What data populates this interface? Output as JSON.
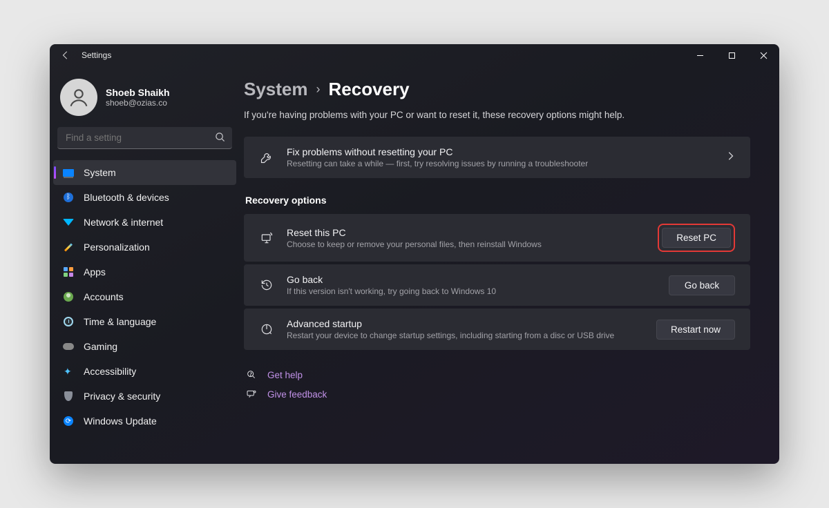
{
  "app_title": "Settings",
  "user": {
    "name": "Shoeb Shaikh",
    "email": "shoeb@ozias.co"
  },
  "search": {
    "placeholder": "Find a setting"
  },
  "nav": {
    "items": [
      {
        "label": "System"
      },
      {
        "label": "Bluetooth & devices"
      },
      {
        "label": "Network & internet"
      },
      {
        "label": "Personalization"
      },
      {
        "label": "Apps"
      },
      {
        "label": "Accounts"
      },
      {
        "label": "Time & language"
      },
      {
        "label": "Gaming"
      },
      {
        "label": "Accessibility"
      },
      {
        "label": "Privacy & security"
      },
      {
        "label": "Windows Update"
      }
    ]
  },
  "breadcrumb": {
    "parent": "System",
    "current": "Recovery"
  },
  "subtitle": "If you're having problems with your PC or want to reset it, these recovery options might help.",
  "trouble": {
    "title": "Fix problems without resetting your PC",
    "desc": "Resetting can take a while — first, try resolving issues by running a troubleshooter"
  },
  "section_header": "Recovery options",
  "options": {
    "reset": {
      "title": "Reset this PC",
      "desc": "Choose to keep or remove your personal files, then reinstall Windows",
      "button": "Reset PC"
    },
    "goback": {
      "title": "Go back",
      "desc": "If this version isn't working, try going back to Windows 10",
      "button": "Go back"
    },
    "advanced": {
      "title": "Advanced startup",
      "desc": "Restart your device to change startup settings, including starting from a disc or USB drive",
      "button": "Restart now"
    }
  },
  "links": {
    "help": "Get help",
    "feedback": "Give feedback"
  }
}
